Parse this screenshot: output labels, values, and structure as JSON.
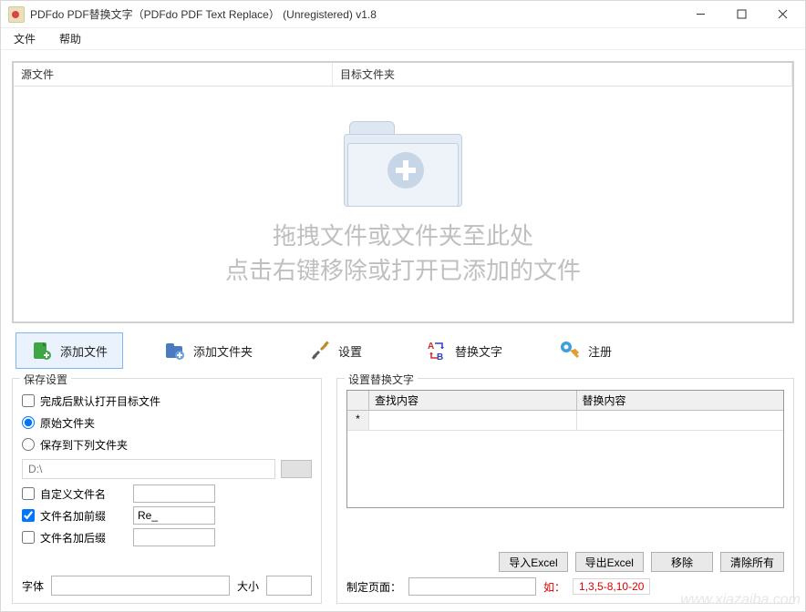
{
  "title": "PDFdo PDF替换文字（PDFdo PDF Text Replace） (Unregistered) v1.8",
  "menu": {
    "file": "文件",
    "help": "帮助"
  },
  "drop": {
    "col_src": "源文件",
    "col_dst": "目标文件夹",
    "line1": "拖拽文件或文件夹至此处",
    "line2": "点击右键移除或打开已添加的文件"
  },
  "toolbar": {
    "add_file": "添加文件",
    "add_folder": "添加文件夹",
    "settings": "设置",
    "replace_text": "替换文字",
    "register": "注册"
  },
  "save": {
    "group": "保存设置",
    "open_after": "完成后默认打开目标文件",
    "orig_folder": "原始文件夹",
    "to_folder": "保存到下列文件夹",
    "dir_value": "D:\\",
    "custom_name": "自定义文件名",
    "prefix": "文件名加前缀",
    "prefix_value": "Re_",
    "suffix": "文件名加后缀",
    "font_label": "字体",
    "size_label": "大小"
  },
  "replace": {
    "group": "设置替换文字",
    "col_find": "查找内容",
    "col_replace": "替换内容",
    "new_row_marker": "*",
    "import_excel": "导入Excel",
    "export_excel": "导出Excel",
    "remove": "移除",
    "clear_all": "清除所有",
    "page_label": "制定页面：",
    "page_value": "",
    "hint_label": "如：",
    "hint_value": "1,3,5-8,10-20"
  },
  "watermark": "www.xiazaiba.com"
}
